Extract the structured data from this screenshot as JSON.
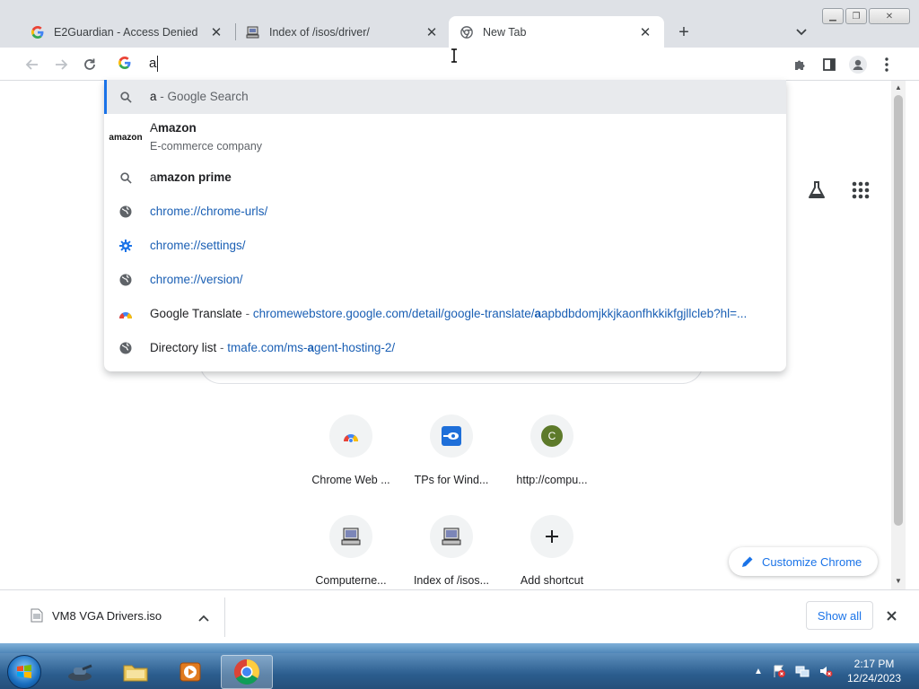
{
  "tabs": [
    {
      "title": "E2Guardian - Access Denied",
      "icon": "google-g-icon",
      "active": false
    },
    {
      "title": "Index of /isos/driver/",
      "icon": "computer-icon",
      "active": false
    },
    {
      "title": "New Tab",
      "icon": "chrome-icon",
      "active": true
    }
  ],
  "omnibox": {
    "value": "a"
  },
  "suggestions": [
    {
      "icon": "search-icon",
      "main": "a",
      "sep": " - ",
      "secondary": "Google Search"
    },
    {
      "icon": "amazon-logo-icon",
      "logo_text": "amazon",
      "main_bold": "mazon",
      "main_lead": "A",
      "sub": "E-commerce company"
    },
    {
      "icon": "search-icon",
      "lead": "a",
      "bold": "mazon prime"
    },
    {
      "icon": "globe-icon",
      "url": "chrome://chrome-urls/"
    },
    {
      "icon": "gear-icon",
      "url": "chrome://settings/"
    },
    {
      "icon": "globe-icon",
      "url": "chrome://version/"
    },
    {
      "icon": "google-translate-icon",
      "title": "Google Translate",
      "sep": " - ",
      "url_pre": "chromewebstore.google.com/detail/google-translate/",
      "url_bold": "a",
      "url_post": "apbdbdomjkkjkaonfhkkikfgjllcleb?hl=..."
    },
    {
      "icon": "globe-icon",
      "title": "Directory list",
      "sep": " - ",
      "url_pre": "tmafe.com/ms-",
      "url_bold": "a",
      "url_post": "gent-hosting-2/"
    }
  ],
  "shortcuts": [
    {
      "label": "Chrome Web ...",
      "icon": "chrome-web-store-icon"
    },
    {
      "label": "TPs for Wind...",
      "icon": "tps-icon"
    },
    {
      "label": "http://compu...",
      "icon": "letter-c-icon",
      "letter": "C",
      "color": "#5d7a2a"
    },
    {
      "label": "Computerne...",
      "icon": "computer-icon"
    },
    {
      "label": "Index of /isos...",
      "icon": "computer-icon"
    },
    {
      "label": "Add shortcut",
      "icon": "plus-icon"
    }
  ],
  "customize_label": "Customize Chrome",
  "download": {
    "filename": "VM8 VGA Drivers.iso",
    "show_all": "Show all"
  },
  "clock": {
    "time": "2:17 PM",
    "date": "12/24/2023"
  },
  "colors": {
    "accent": "#1a73e8",
    "url": "#1a5fb4"
  }
}
